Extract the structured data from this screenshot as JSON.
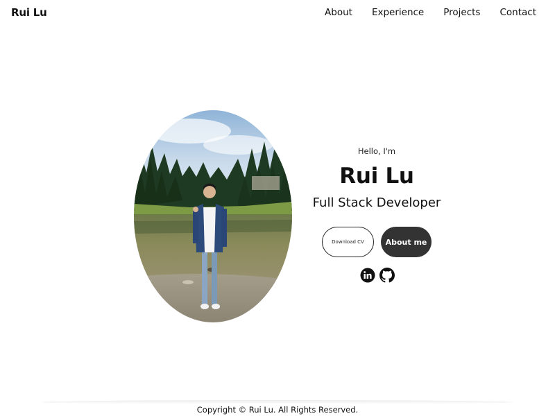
{
  "header": {
    "logo": "Rui Lu",
    "nav": [
      "About",
      "Experience",
      "Projects",
      "Contact"
    ]
  },
  "hero": {
    "greeting": "Hello, I'm",
    "name": "Rui Lu",
    "title": "Full Stack Developer",
    "download_cv_label": "Download CV",
    "about_me_label": "About me"
  },
  "socials": {
    "icons": [
      "linkedin-icon",
      "github-icon"
    ]
  },
  "footer": {
    "copyright": "Copyright © Rui Lu. All Rights Reserved."
  },
  "colors": {
    "primary_button": "#333333",
    "text": "#111111",
    "background": "#ffffff"
  }
}
